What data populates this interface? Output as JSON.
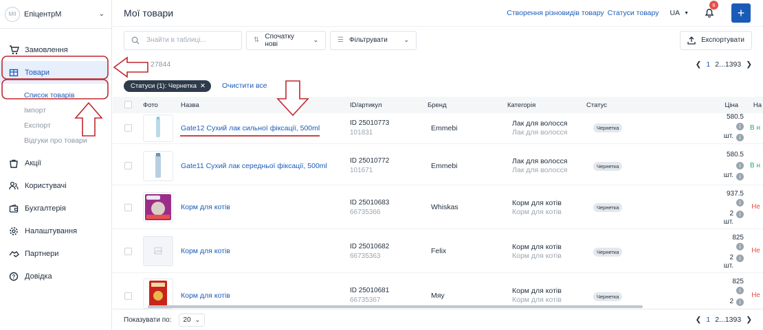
{
  "sidebar": {
    "company": "ЕпіцентрМ",
    "avatar": "МІІ",
    "items": [
      {
        "label": "Замовлення"
      },
      {
        "label": "Товари"
      },
      {
        "label": "Акції"
      },
      {
        "label": "Користувачі"
      },
      {
        "label": "Бухгалтерія"
      },
      {
        "label": "Налаштування"
      },
      {
        "label": "Партнери"
      },
      {
        "label": "Довідка"
      }
    ],
    "subitems": [
      {
        "label": "Список товарів"
      },
      {
        "label": "Імпорт"
      },
      {
        "label": "Експорт"
      },
      {
        "label": "Відгуки про товари"
      }
    ]
  },
  "header": {
    "title": "Мої товари",
    "link_variants": "Створення різновидів товару",
    "link_statuses": "Статуси товару",
    "lang": "UA",
    "notifications": "6",
    "add": "+"
  },
  "toolbar": {
    "search_placeholder": "Знайти в таблиці...",
    "sort_label": "Спочатку нові",
    "filter_label": "Фільтрувати",
    "export_label": "Експортувати"
  },
  "count": "27844",
  "pager": {
    "current": "1",
    "rest": "2...1393"
  },
  "filter": {
    "chip": "Статуси (1): Чернетка",
    "clear": "Очистити все"
  },
  "columns": {
    "photo": "Фото",
    "name": "Назва",
    "id": "ID/артикул",
    "brand": "Бренд",
    "category": "Категорія",
    "status": "Статус",
    "price": "Ціна",
    "avail": "На"
  },
  "rows": [
    {
      "name": "Gate12 Сухий лак сильної фіксації, 500ml",
      "id": "ID 25010773",
      "art": "101831",
      "brand": "Emmebi",
      "cat1": "Лак для волосся",
      "cat2": "Лак для волосся",
      "status": "Чернетка",
      "price": "580.5",
      "qty": "",
      "unit": "шт.",
      "avail": "В н",
      "avail_color": "#2fa36b"
    },
    {
      "name": "Gate11 Сухий лак середньої фіксації, 500ml",
      "id": "ID 25010772",
      "art": "101671",
      "brand": "Emmebi",
      "cat1": "Лак для волосся",
      "cat2": "Лак для волосся",
      "status": "Чернетка",
      "price": "580.5",
      "qty": "",
      "unit": "шт.",
      "avail": "В н",
      "avail_color": "#2fa36b"
    },
    {
      "name": "Корм для котів",
      "id": "ID 25010683",
      "art": "66735366",
      "brand": "Whiskas",
      "cat1": "Корм для котів",
      "cat2": "Корм для котів",
      "status": "Чернетка",
      "price": "937.5",
      "qty": "2",
      "unit": "шт.",
      "avail": "Не",
      "avail_color": "#e0524a"
    },
    {
      "name": "Корм для котів",
      "id": "ID 25010682",
      "art": "66735363",
      "brand": "Felix",
      "cat1": "Корм для котів",
      "cat2": "Корм для котів",
      "status": "Чернетка",
      "price": "825",
      "qty": "2",
      "unit": "шт.",
      "avail": "Не",
      "avail_color": "#e0524a"
    },
    {
      "name": "Корм для котів",
      "id": "ID 25010681",
      "art": "66735367",
      "brand": "Мяу",
      "cat1": "Корм для котів",
      "cat2": "Корм для котів",
      "status": "Чернетка",
      "price": "825",
      "qty": "2",
      "unit": "шт.",
      "avail": "Не",
      "avail_color": "#e0524a"
    }
  ],
  "footer": {
    "show_label": "Показувати по:",
    "page_size": "20"
  },
  "colors": {
    "accent": "#1a5bb8",
    "annotation": "#c0262d"
  }
}
